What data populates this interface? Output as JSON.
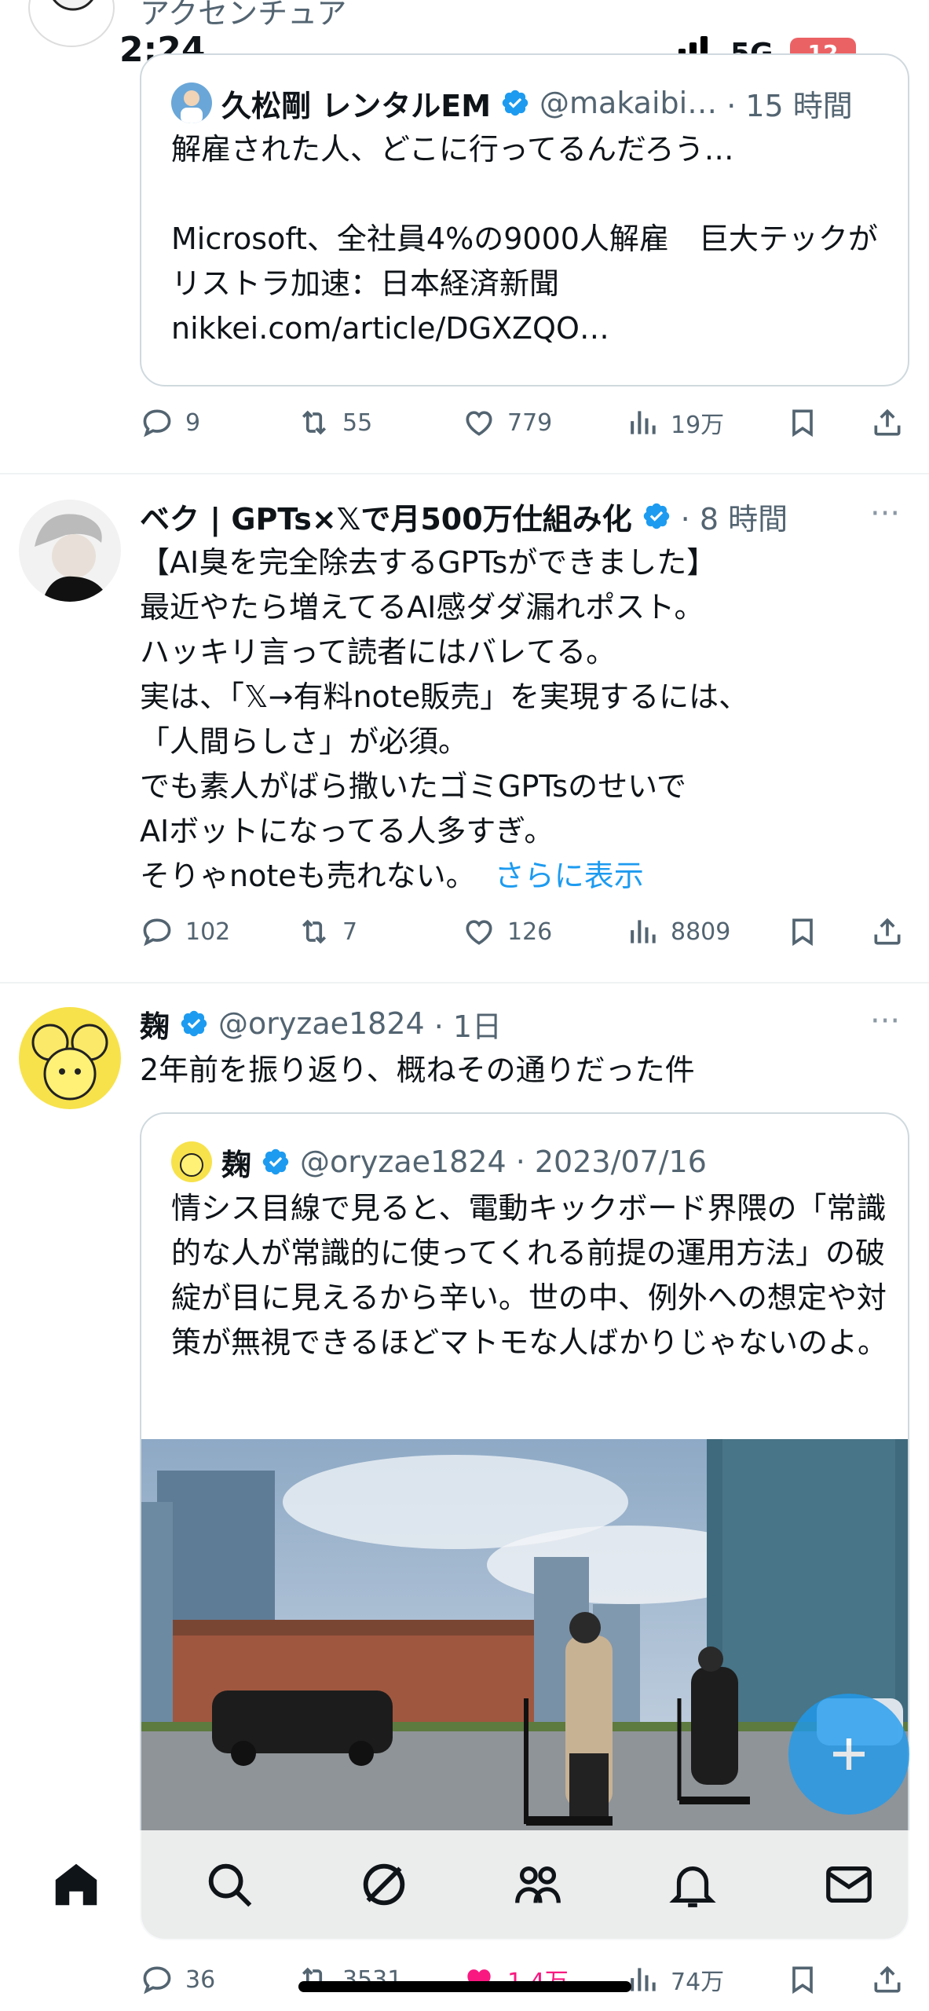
{
  "status_bar": {
    "time": "2:24",
    "network": "5G",
    "battery": "12"
  },
  "top_post": {
    "author_partial": "アクセンチュア",
    "quote": {
      "author": "久松剛 レンタルEM",
      "handle": "@makaibi…",
      "time": "· 15 時間",
      "text": "解雇された人、どこに行ってるんだろう…\n\nMicrosoft、全社員4%の9000人解雇　巨大テックがリストラ加速：日本経済新聞\nnikkei.com/article/DGXZQO…"
    },
    "actions": {
      "replies": "9",
      "reposts": "55",
      "likes": "779",
      "views": "19万"
    }
  },
  "post2": {
    "author": "ベク | GPTs×𝕏で月500万仕組み化",
    "time": "· 8 時間",
    "text": "【AI臭を完全除去するGPTsができました】\n最近やたら増えてるAI感ダダ漏れポスト。\nハッキリ言って読者にはバレてる。\n実は、「𝕏→有料note販売」を実現するには、\n「人間らしさ」が必須。\nでも素人がばら撒いたゴミGPTsのせいで\nAIボットになってる人多すぎ。\nそりゃnoteも売れない。",
    "show_more": "さらに表示",
    "actions": {
      "replies": "102",
      "reposts": "7",
      "likes": "126",
      "views": "8809"
    }
  },
  "post3": {
    "author": "麹",
    "handle": "@oryzae1824",
    "time": "· 1日",
    "text": "2年前を振り返り、概ねその通りだった件",
    "quote": {
      "author": "麹",
      "handle": "@oryzae1824",
      "time": "· 2023/07/16",
      "text": "情シス目線で見ると、電動キックボード界隈の「常識的な人が常識的に使ってくれる前提の運用方法」の破綻が目に見えるから辛い。世の中、例外への想定や対策が無視できるほどマトモな人ばかりじゃないのよ。"
    },
    "actions": {
      "replies": "36",
      "reposts": "3531",
      "likes": "1.4万",
      "views": "74万"
    }
  },
  "colors": {
    "accent": "#1d9bf0",
    "text": "#0f1419",
    "secondary": "#536471",
    "like": "#f91880"
  }
}
